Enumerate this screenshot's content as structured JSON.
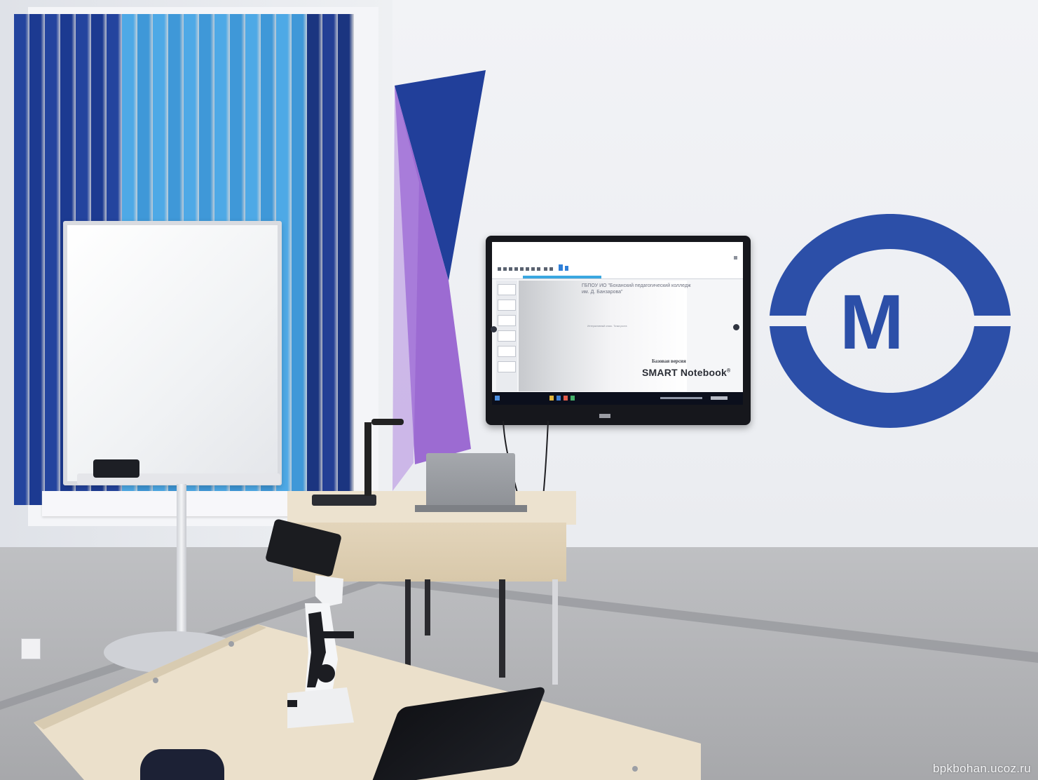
{
  "screen": {
    "college_heading": "ГБПОУ ИО \"Боханский педагогический колледж им. Д. Банзарова\"",
    "small_caption": "Интерактивный класс. Точка роста",
    "edition_label": "Базовая версия",
    "product_name": "SMART Notebook",
    "registered_mark": "®"
  },
  "wall_logo": {
    "letter": "M",
    "color": "#2c4fa8"
  },
  "watermark": "bpkbohan.ucoz.ru",
  "colors": {
    "blind_dark": "#1e3a8f",
    "blind_light": "#4aa5e2",
    "purple_accent": "#9666cf",
    "wall": "#eef0f3"
  }
}
